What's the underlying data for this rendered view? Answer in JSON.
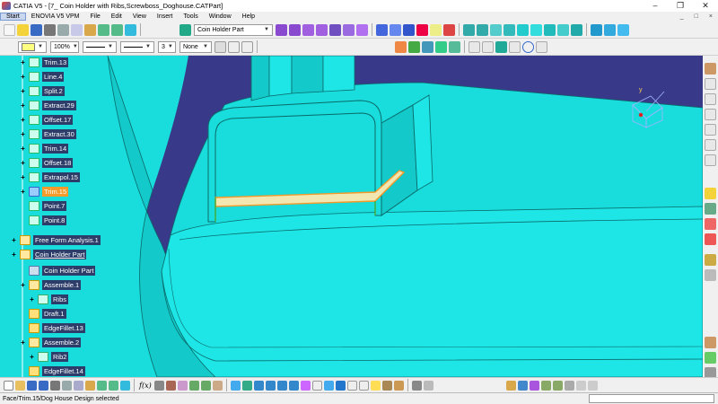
{
  "window": {
    "title": "CATIA V5 - [7_ Coin Holder with Ribs,Screwboss_Doghouse.CATPart]",
    "minimize": "–",
    "restore": "❐",
    "close": "✕"
  },
  "menu": {
    "items": [
      "Start",
      "ENOVIA V5 VPM",
      "File",
      "Edit",
      "View",
      "Insert",
      "Tools",
      "Window",
      "Help"
    ],
    "right": [
      "_",
      "□",
      "×"
    ]
  },
  "toolbar": {
    "part_combo": "Coin Holder Part",
    "zoom_combo": "100%",
    "thickness_combo": "3",
    "layer_combo": "None"
  },
  "tree": {
    "items": [
      {
        "label": "Trim.13",
        "selected": false,
        "plus": true
      },
      {
        "label": "Line.4",
        "selected": false,
        "plus": true
      },
      {
        "label": "Split.2",
        "selected": false,
        "plus": true
      },
      {
        "label": "Extract.29",
        "selected": false,
        "plus": true
      },
      {
        "label": "Offset.17",
        "selected": false,
        "plus": true
      },
      {
        "label": "Extract.30",
        "selected": false,
        "plus": true
      },
      {
        "label": "Trim.14",
        "selected": false,
        "plus": true
      },
      {
        "label": "Offset.18",
        "selected": false,
        "plus": true
      },
      {
        "label": "Extrapol.15",
        "selected": false,
        "plus": true
      },
      {
        "label": "Trim.15",
        "selected": true,
        "plus": true
      },
      {
        "label": "Point.7",
        "selected": false,
        "plus": false
      },
      {
        "label": "Point.8",
        "selected": false,
        "plus": false
      },
      {
        "label": "Free Form Analysis.1",
        "selected": false,
        "plus": true
      },
      {
        "label": "Coin Holder Part",
        "selected": false,
        "plus": true,
        "underline": true
      },
      {
        "label": "Coin Holder Part",
        "selected": false,
        "plus": false
      },
      {
        "label": "Assemble.1",
        "selected": false,
        "plus": true
      },
      {
        "label": "Ribs",
        "selected": false,
        "plus": true
      },
      {
        "label": "Draft.1",
        "selected": false,
        "plus": false
      },
      {
        "label": "EdgeFillet.13",
        "selected": false,
        "plus": false
      },
      {
        "label": "Assemble.2",
        "selected": false,
        "plus": true
      },
      {
        "label": "Rib2",
        "selected": false,
        "plus": true
      },
      {
        "label": "EdgeFillet.14",
        "selected": false,
        "plus": false
      }
    ]
  },
  "compass": {
    "axis_label": "y"
  },
  "bottom": {
    "formula_label": "f(x)"
  },
  "status": {
    "text": "Face/Trim.15/Dog House Design selected"
  },
  "colors": {
    "surface": "#18e0e0",
    "background": "#39398a",
    "selection": "#f39a2b",
    "face_highlight": "#f2e7b0"
  }
}
